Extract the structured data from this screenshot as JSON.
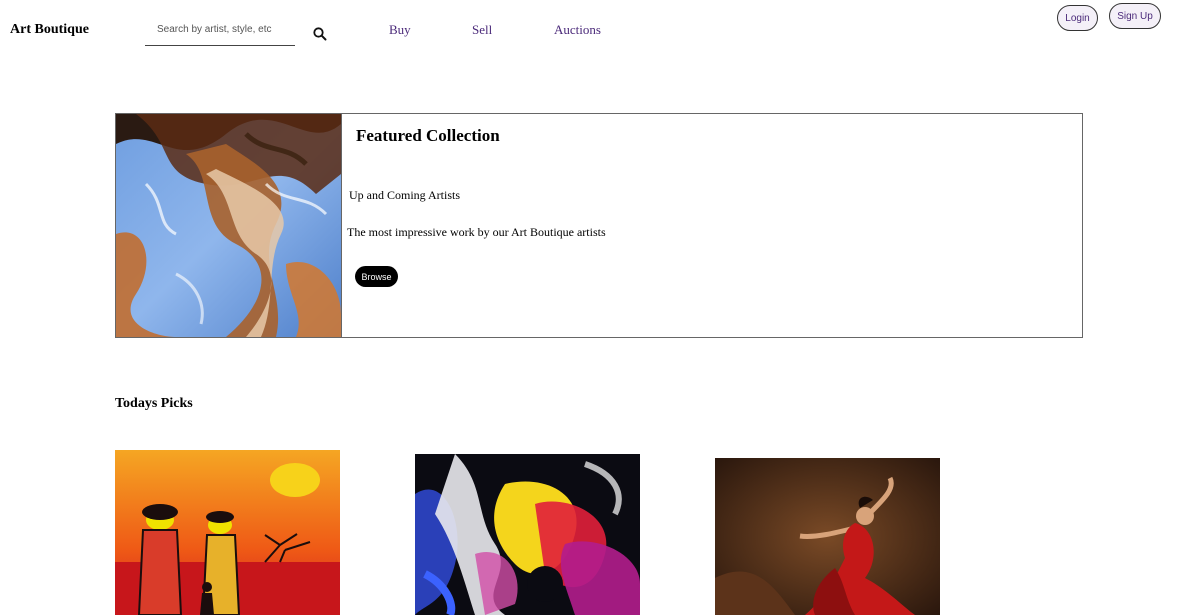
{
  "header": {
    "brand": "Art Boutique",
    "search": {
      "placeholder": "Search by artist, style, etc",
      "value": ""
    },
    "search_icon": "magnifier-icon",
    "nav": [
      {
        "label": "Buy"
      },
      {
        "label": "Sell"
      },
      {
        "label": "Auctions"
      }
    ],
    "login_label": "Login",
    "signup_label": "Sign Up"
  },
  "featured": {
    "title": "Featured Collection",
    "subtitle": "Up and Coming Artists",
    "description": "The most impressive work by our Art Boutique artists",
    "browse_label": "Browse",
    "image": "abstract-fluid-painting"
  },
  "picks": {
    "heading": "Todays Picks",
    "items": [
      {
        "image": "african-sunset-painting"
      },
      {
        "image": "abstract-color-painting"
      },
      {
        "image": "flamenco-dancer-painting"
      }
    ]
  },
  "colors": {
    "nav_link": "#4b2a7a",
    "button_bg": "#f4f0f8",
    "browse_bg": "#000000",
    "border": "#666666"
  }
}
